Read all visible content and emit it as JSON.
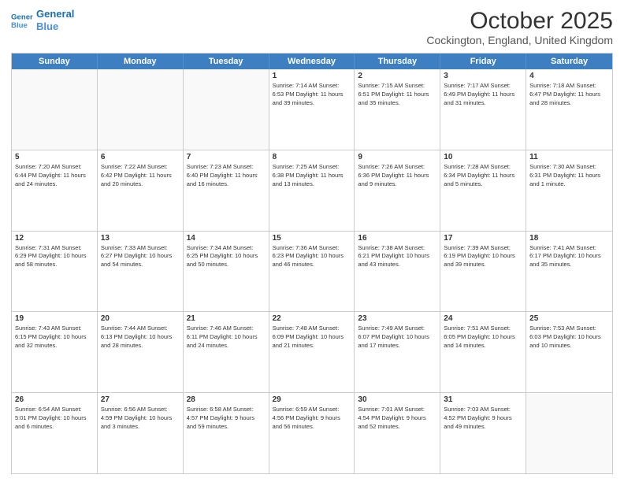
{
  "header": {
    "logo_line1": "General",
    "logo_line2": "Blue",
    "title": "October 2025",
    "subtitle": "Cockington, England, United Kingdom"
  },
  "days_of_week": [
    "Sunday",
    "Monday",
    "Tuesday",
    "Wednesday",
    "Thursday",
    "Friday",
    "Saturday"
  ],
  "weeks": [
    [
      {
        "day": "",
        "info": ""
      },
      {
        "day": "",
        "info": ""
      },
      {
        "day": "",
        "info": ""
      },
      {
        "day": "1",
        "info": "Sunrise: 7:14 AM\nSunset: 6:53 PM\nDaylight: 11 hours and 39 minutes."
      },
      {
        "day": "2",
        "info": "Sunrise: 7:15 AM\nSunset: 6:51 PM\nDaylight: 11 hours and 35 minutes."
      },
      {
        "day": "3",
        "info": "Sunrise: 7:17 AM\nSunset: 6:49 PM\nDaylight: 11 hours and 31 minutes."
      },
      {
        "day": "4",
        "info": "Sunrise: 7:18 AM\nSunset: 6:47 PM\nDaylight: 11 hours and 28 minutes."
      }
    ],
    [
      {
        "day": "5",
        "info": "Sunrise: 7:20 AM\nSunset: 6:44 PM\nDaylight: 11 hours and 24 minutes."
      },
      {
        "day": "6",
        "info": "Sunrise: 7:22 AM\nSunset: 6:42 PM\nDaylight: 11 hours and 20 minutes."
      },
      {
        "day": "7",
        "info": "Sunrise: 7:23 AM\nSunset: 6:40 PM\nDaylight: 11 hours and 16 minutes."
      },
      {
        "day": "8",
        "info": "Sunrise: 7:25 AM\nSunset: 6:38 PM\nDaylight: 11 hours and 13 minutes."
      },
      {
        "day": "9",
        "info": "Sunrise: 7:26 AM\nSunset: 6:36 PM\nDaylight: 11 hours and 9 minutes."
      },
      {
        "day": "10",
        "info": "Sunrise: 7:28 AM\nSunset: 6:34 PM\nDaylight: 11 hours and 5 minutes."
      },
      {
        "day": "11",
        "info": "Sunrise: 7:30 AM\nSunset: 6:31 PM\nDaylight: 11 hours and 1 minute."
      }
    ],
    [
      {
        "day": "12",
        "info": "Sunrise: 7:31 AM\nSunset: 6:29 PM\nDaylight: 10 hours and 58 minutes."
      },
      {
        "day": "13",
        "info": "Sunrise: 7:33 AM\nSunset: 6:27 PM\nDaylight: 10 hours and 54 minutes."
      },
      {
        "day": "14",
        "info": "Sunrise: 7:34 AM\nSunset: 6:25 PM\nDaylight: 10 hours and 50 minutes."
      },
      {
        "day": "15",
        "info": "Sunrise: 7:36 AM\nSunset: 6:23 PM\nDaylight: 10 hours and 46 minutes."
      },
      {
        "day": "16",
        "info": "Sunrise: 7:38 AM\nSunset: 6:21 PM\nDaylight: 10 hours and 43 minutes."
      },
      {
        "day": "17",
        "info": "Sunrise: 7:39 AM\nSunset: 6:19 PM\nDaylight: 10 hours and 39 minutes."
      },
      {
        "day": "18",
        "info": "Sunrise: 7:41 AM\nSunset: 6:17 PM\nDaylight: 10 hours and 35 minutes."
      }
    ],
    [
      {
        "day": "19",
        "info": "Sunrise: 7:43 AM\nSunset: 6:15 PM\nDaylight: 10 hours and 32 minutes."
      },
      {
        "day": "20",
        "info": "Sunrise: 7:44 AM\nSunset: 6:13 PM\nDaylight: 10 hours and 28 minutes."
      },
      {
        "day": "21",
        "info": "Sunrise: 7:46 AM\nSunset: 6:11 PM\nDaylight: 10 hours and 24 minutes."
      },
      {
        "day": "22",
        "info": "Sunrise: 7:48 AM\nSunset: 6:09 PM\nDaylight: 10 hours and 21 minutes."
      },
      {
        "day": "23",
        "info": "Sunrise: 7:49 AM\nSunset: 6:07 PM\nDaylight: 10 hours and 17 minutes."
      },
      {
        "day": "24",
        "info": "Sunrise: 7:51 AM\nSunset: 6:05 PM\nDaylight: 10 hours and 14 minutes."
      },
      {
        "day": "25",
        "info": "Sunrise: 7:53 AM\nSunset: 6:03 PM\nDaylight: 10 hours and 10 minutes."
      }
    ],
    [
      {
        "day": "26",
        "info": "Sunrise: 6:54 AM\nSunset: 5:01 PM\nDaylight: 10 hours and 6 minutes."
      },
      {
        "day": "27",
        "info": "Sunrise: 6:56 AM\nSunset: 4:59 PM\nDaylight: 10 hours and 3 minutes."
      },
      {
        "day": "28",
        "info": "Sunrise: 6:58 AM\nSunset: 4:57 PM\nDaylight: 9 hours and 59 minutes."
      },
      {
        "day": "29",
        "info": "Sunrise: 6:59 AM\nSunset: 4:56 PM\nDaylight: 9 hours and 56 minutes."
      },
      {
        "day": "30",
        "info": "Sunrise: 7:01 AM\nSunset: 4:54 PM\nDaylight: 9 hours and 52 minutes."
      },
      {
        "day": "31",
        "info": "Sunrise: 7:03 AM\nSunset: 4:52 PM\nDaylight: 9 hours and 49 minutes."
      },
      {
        "day": "",
        "info": ""
      }
    ]
  ]
}
